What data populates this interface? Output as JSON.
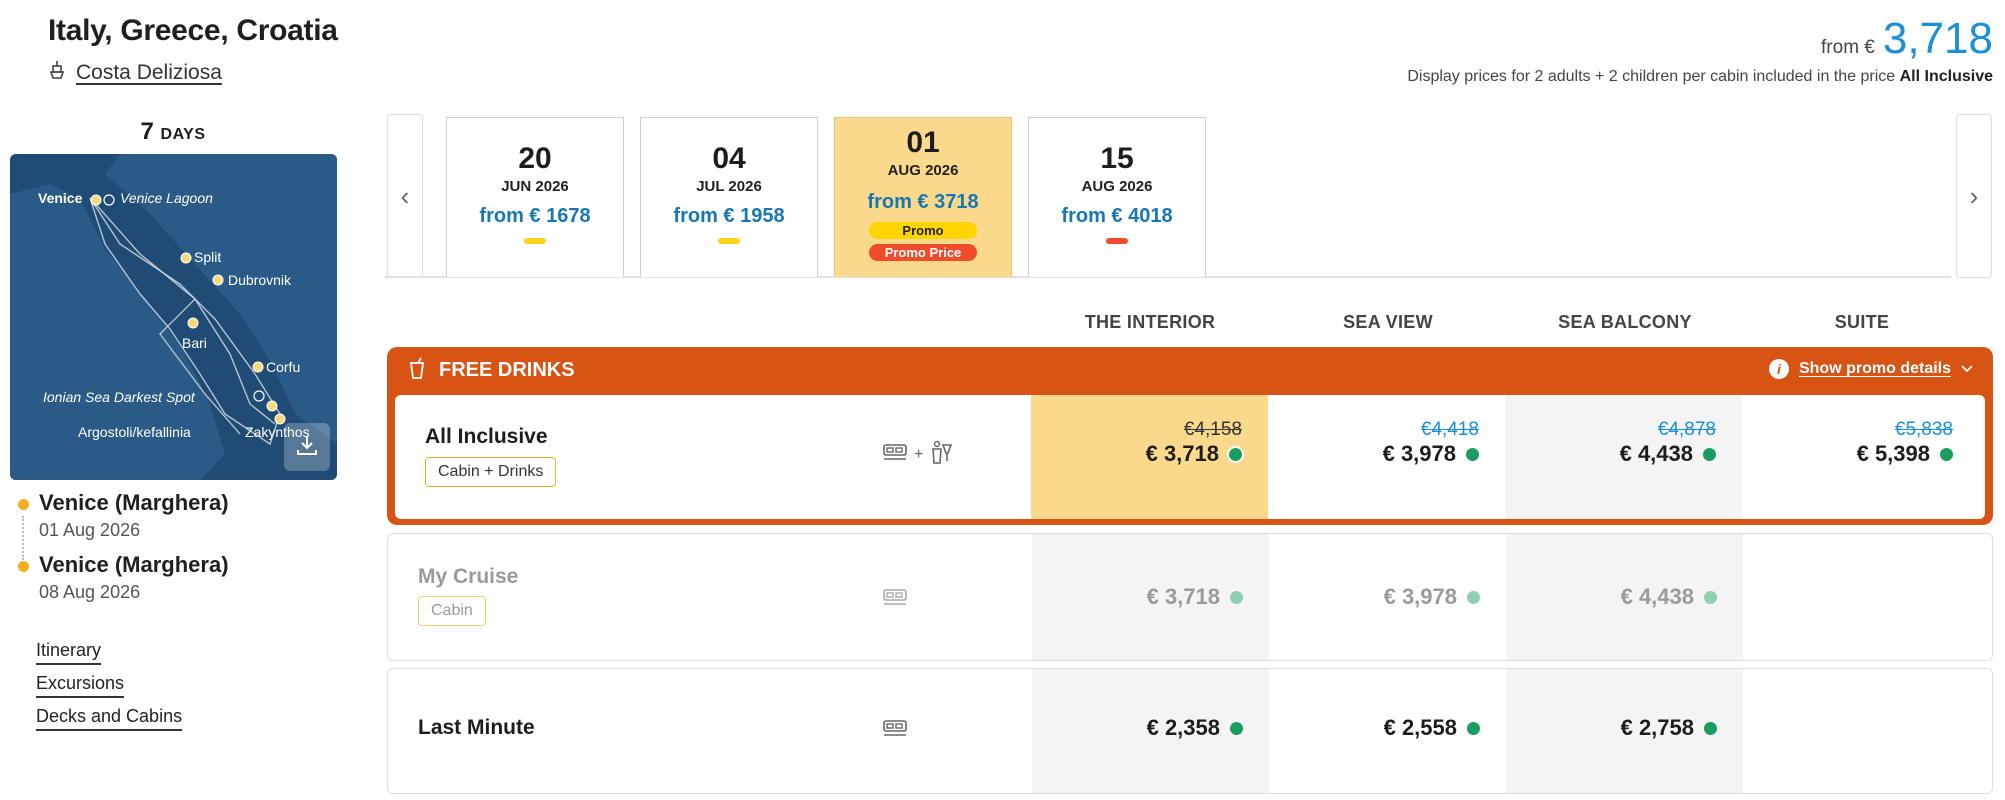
{
  "header": {
    "title": "Italy, Greece, Croatia",
    "ship_name": "Costa Deliziosa",
    "price_from_label": "from €",
    "price_from_value": "3,718",
    "display_note": "Display prices for 2 adults + 2 children per cabin included in the price",
    "display_note_bold": "All Inclusive"
  },
  "sidebar": {
    "days_number": "7",
    "days_label": "DAYS",
    "map_labels": {
      "venice": "Venice",
      "venice_lagoon": "Venice Lagoon",
      "split": "Split",
      "dubrovnik": "Dubrovnik",
      "bari": "Bari",
      "corfu": "Corfu",
      "ionian": "Ionian Sea Darkest Spot",
      "argostoli": "Argostoli/kefallinia",
      "zakynthos": "Zakynthos"
    },
    "departure": {
      "port": "Venice (Marghera)",
      "date": "01 Aug 2026"
    },
    "arrival": {
      "port": "Venice (Marghera)",
      "date": "08 Aug 2026"
    },
    "links": [
      "Itinerary",
      "Excursions",
      "Decks and Cabins"
    ]
  },
  "dates": [
    {
      "day": "20",
      "month_year": "JUN 2026",
      "price": "from € 1678",
      "bar_color": "#ffd31a",
      "selected": false
    },
    {
      "day": "04",
      "month_year": "JUL 2026",
      "price": "from € 1958",
      "bar_color": "#ffd31a",
      "selected": false
    },
    {
      "day": "01",
      "month_year": "AUG 2026",
      "price": "from € 3718",
      "badge_promo": "Promo",
      "badge_promo_price": "Promo Price",
      "selected": true
    },
    {
      "day": "15",
      "month_year": "AUG 2026",
      "price": "from € 4018",
      "bar_color": "#f04b2b",
      "selected": false
    }
  ],
  "columns": [
    "THE INTERIOR",
    "SEA VIEW",
    "SEA BALCONY",
    "SUITE"
  ],
  "promo_banner": {
    "label": "FREE DRINKS",
    "details_link": "Show promo details"
  },
  "rates": [
    {
      "name": "All Inclusive",
      "tag": "Cabin + Drinks",
      "prices": [
        {
          "old": "€4,158",
          "new": "€ 3,718"
        },
        {
          "old": "€4,418",
          "new": "€ 3,978"
        },
        {
          "old": "€4,878",
          "new": "€ 4,438"
        },
        {
          "old": "€5,838",
          "new": "€ 5,398"
        }
      ]
    },
    {
      "name": "My Cruise",
      "tag": "Cabin",
      "prices": [
        {
          "new": "€ 3,718"
        },
        {
          "new": "€ 3,978"
        },
        {
          "new": "€ 4,438"
        }
      ]
    },
    {
      "name": "Last Minute",
      "prices": [
        {
          "new": "€ 2,358"
        },
        {
          "new": "€ 2,558"
        },
        {
          "new": "€ 2,758"
        }
      ]
    }
  ],
  "colors": {
    "accent_blue": "#1b8fd8",
    "promo_orange": "#d75414",
    "selected_yellow": "#fbd98c",
    "available_green": "#1a9d61"
  }
}
